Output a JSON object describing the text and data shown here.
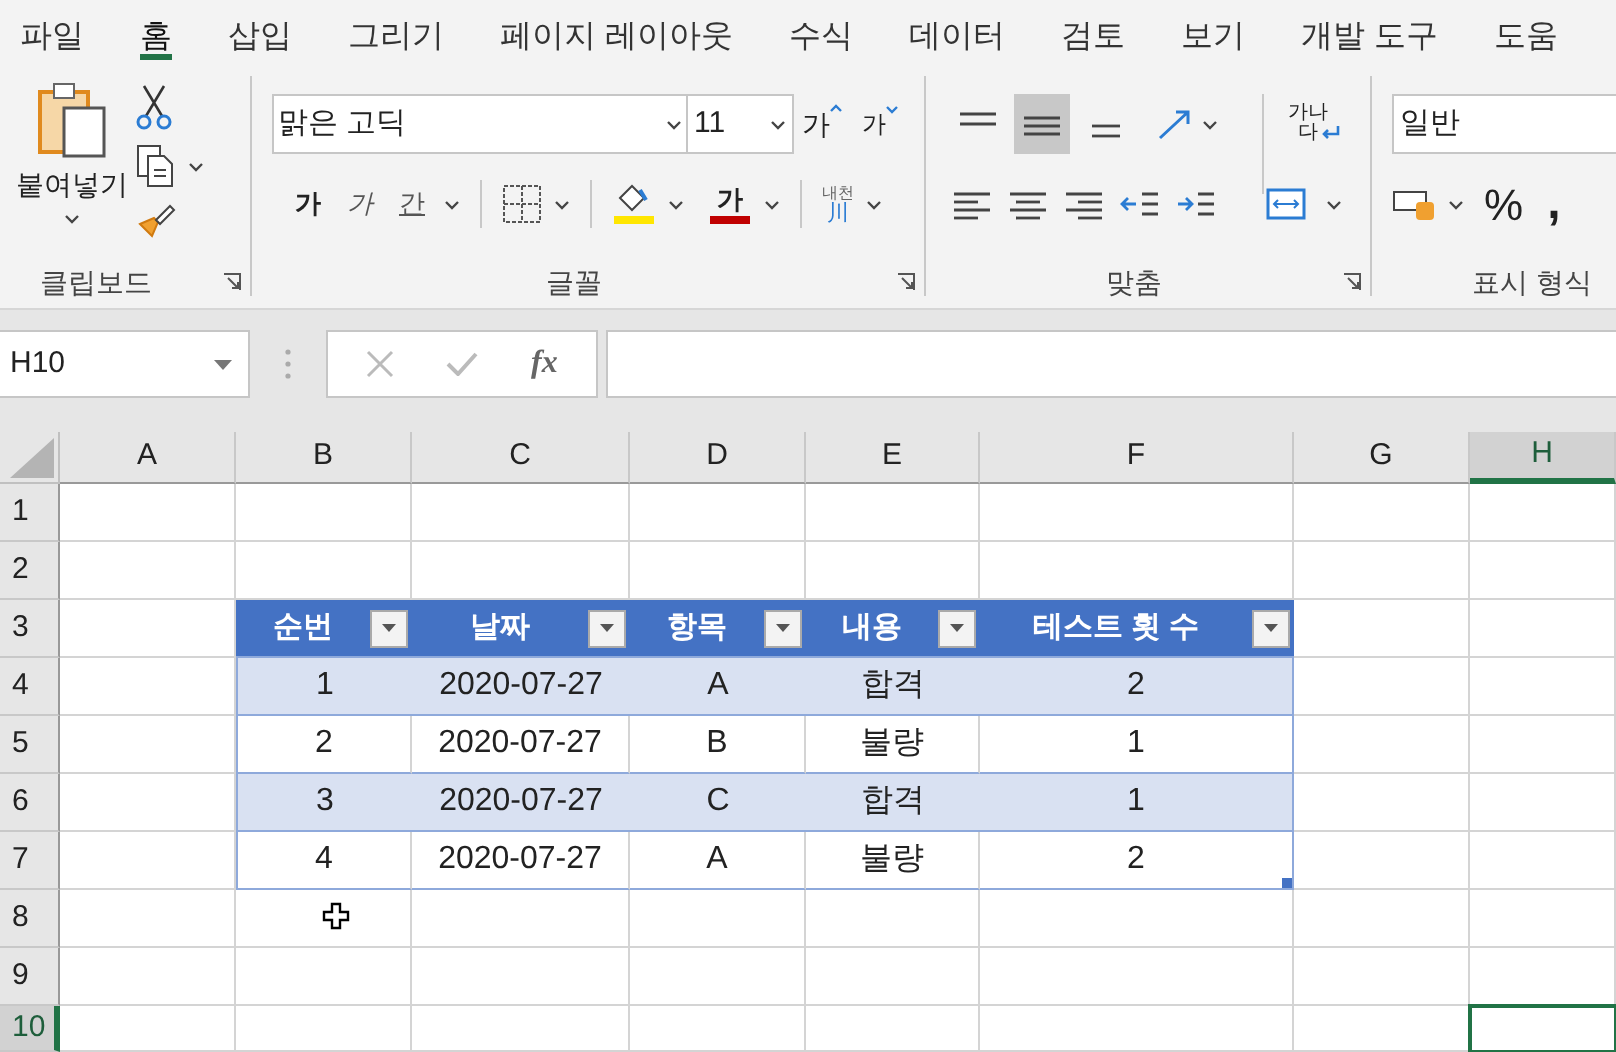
{
  "tabs": [
    {
      "label": "파일",
      "selected": false
    },
    {
      "label": "홈",
      "selected": true
    },
    {
      "label": "삽입",
      "selected": false
    },
    {
      "label": "그리기",
      "selected": false
    },
    {
      "label": "페이지 레이아웃",
      "selected": false
    },
    {
      "label": "수식",
      "selected": false
    },
    {
      "label": "데이터",
      "selected": false
    },
    {
      "label": "검토",
      "selected": false
    },
    {
      "label": "보기",
      "selected": false
    },
    {
      "label": "개발 도구",
      "selected": false
    },
    {
      "label": "도움",
      "selected": false
    }
  ],
  "clipboard": {
    "paste_label": "붙여넣기",
    "group_label": "클립보드"
  },
  "font": {
    "font_name": "맑은 고딕",
    "font_size": "11",
    "grow_label": "가",
    "shrink_label": "가",
    "bold_label": "가",
    "italic_label": "가",
    "underline_label": "간",
    "font_color_label": "가",
    "phonetic_label": "내천",
    "phonetic_glyph": "川",
    "group_label": "글꼴"
  },
  "alignment": {
    "vertical": [
      {
        "kind": "top",
        "selected": false
      },
      {
        "kind": "middle",
        "selected": true
      },
      {
        "kind": "bottom",
        "selected": false
      }
    ],
    "wrap_label_top": "가나",
    "wrap_label_bottom": "다",
    "group_label": "맞춤"
  },
  "number": {
    "format": "일반",
    "percent": "%",
    "comma": ",",
    "group_label": "표시 형식"
  },
  "formula_bar": {
    "name_box": "H10",
    "fx": "fx"
  },
  "sheet": {
    "columns": [
      {
        "label": "A",
        "selected": false
      },
      {
        "label": "B",
        "selected": false
      },
      {
        "label": "C",
        "selected": false
      },
      {
        "label": "D",
        "selected": false
      },
      {
        "label": "E",
        "selected": false
      },
      {
        "label": "F",
        "selected": false
      },
      {
        "label": "G",
        "selected": false
      },
      {
        "label": "H",
        "selected": true
      }
    ],
    "rows": [
      {
        "label": "1",
        "selected": false
      },
      {
        "label": "2",
        "selected": false
      },
      {
        "label": "3",
        "selected": false
      },
      {
        "label": "4",
        "selected": false
      },
      {
        "label": "5",
        "selected": false
      },
      {
        "label": "6",
        "selected": false
      },
      {
        "label": "7",
        "selected": false
      },
      {
        "label": "8",
        "selected": false
      },
      {
        "label": "9",
        "selected": false
      },
      {
        "label": "10",
        "selected": true
      }
    ]
  },
  "table": {
    "columns": [
      "순번",
      "날짜",
      "항목",
      "내용",
      "테스트 횟 수"
    ],
    "rows": [
      [
        "1",
        "2020-07-27",
        "A",
        "합격",
        "2"
      ],
      [
        "2",
        "2020-07-27",
        "B",
        "불량",
        "1"
      ],
      [
        "3",
        "2020-07-27",
        "C",
        "합격",
        "1"
      ],
      [
        "4",
        "2020-07-27",
        "A",
        "불량",
        "2"
      ]
    ]
  }
}
